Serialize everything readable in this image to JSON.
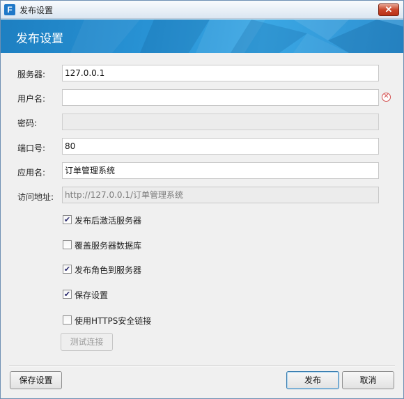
{
  "window": {
    "title": "发布设置",
    "app_icon_letter": "F",
    "close_glyph": "✕"
  },
  "header": {
    "title": "发布设置"
  },
  "form": {
    "server": {
      "label": "服务器:",
      "value": "127.0.0.1"
    },
    "username": {
      "label": "用户名:",
      "value": "",
      "has_error": true
    },
    "password": {
      "label": "密码:",
      "value": ""
    },
    "port": {
      "label": "端口号:",
      "value": "80"
    },
    "app_name": {
      "label": "应用名:",
      "value": "订单管理系统"
    },
    "access_url": {
      "label": "访问地址:",
      "value": "http://127.0.0.1/订单管理系统"
    }
  },
  "options": [
    {
      "label": "发布后激活服务器",
      "checked": true
    },
    {
      "label": "覆盖服务器数据库",
      "checked": false
    },
    {
      "label": "发布角色到服务器",
      "checked": true
    },
    {
      "label": "保存设置",
      "checked": true
    },
    {
      "label": "使用HTTPS安全链接",
      "checked": false
    }
  ],
  "buttons": {
    "test_connection": "测试连接",
    "save_settings": "保存设置",
    "publish": "发布",
    "cancel": "取消"
  },
  "icons": {
    "check": "✔",
    "error": "✕"
  },
  "colors": {
    "banner": "#2994d6",
    "error": "#d24d4d"
  }
}
